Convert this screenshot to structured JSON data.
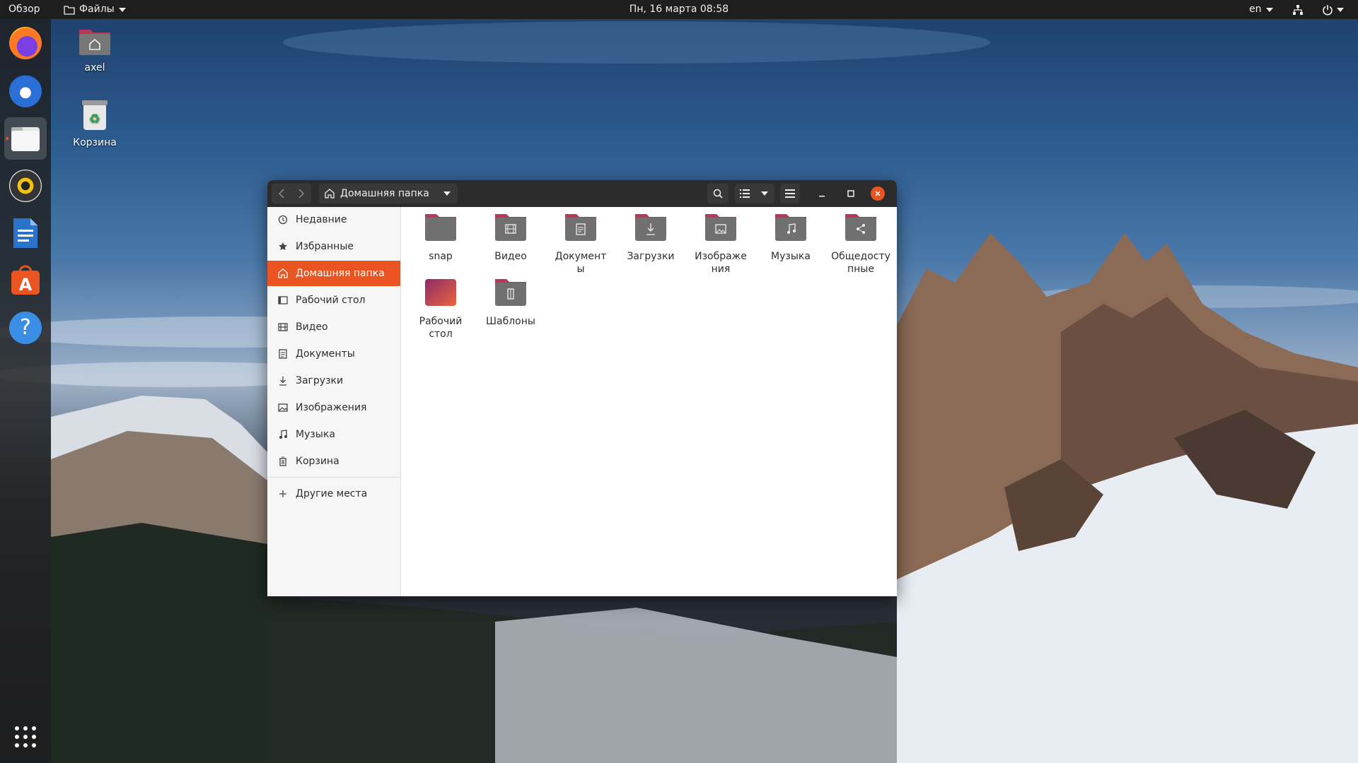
{
  "topbar": {
    "activities": "Обзор",
    "app_menu": "Файлы",
    "clock": "Пн, 16 марта  08:58",
    "language": "en"
  },
  "dock": {
    "items": [
      {
        "name": "firefox"
      },
      {
        "name": "thunderbird"
      },
      {
        "name": "files",
        "active": true
      },
      {
        "name": "rhythmbox"
      },
      {
        "name": "libreoffice-writer"
      },
      {
        "name": "ubuntu-software"
      },
      {
        "name": "help"
      }
    ]
  },
  "desktop": {
    "home_label": "axel",
    "trash_label": "Корзина"
  },
  "window": {
    "path_label": "Домашняя папка",
    "sidebar": {
      "recent": "Недавние",
      "starred": "Избранные",
      "home": "Домашняя папка",
      "desktop": "Рабочий стол",
      "videos": "Видео",
      "documents": "Документы",
      "downloads": "Загрузки",
      "pictures": "Изображения",
      "music": "Музыка",
      "trash": "Корзина",
      "other": "Другие места"
    },
    "files": {
      "snap": "snap",
      "videos": "Видео",
      "documents": "Документ\nы",
      "downloads": "Загрузки",
      "pictures": "Изображе\nния",
      "music": "Музыка",
      "public": "Общедосту\nпные",
      "desktop": "Рабочий\nстол",
      "templates": "Шаблоны"
    }
  },
  "colors": {
    "accent": "#e95420",
    "headerbar": "#2c2c2c",
    "folder_top": "#c04060",
    "folder_body": "#6e6e6e"
  }
}
